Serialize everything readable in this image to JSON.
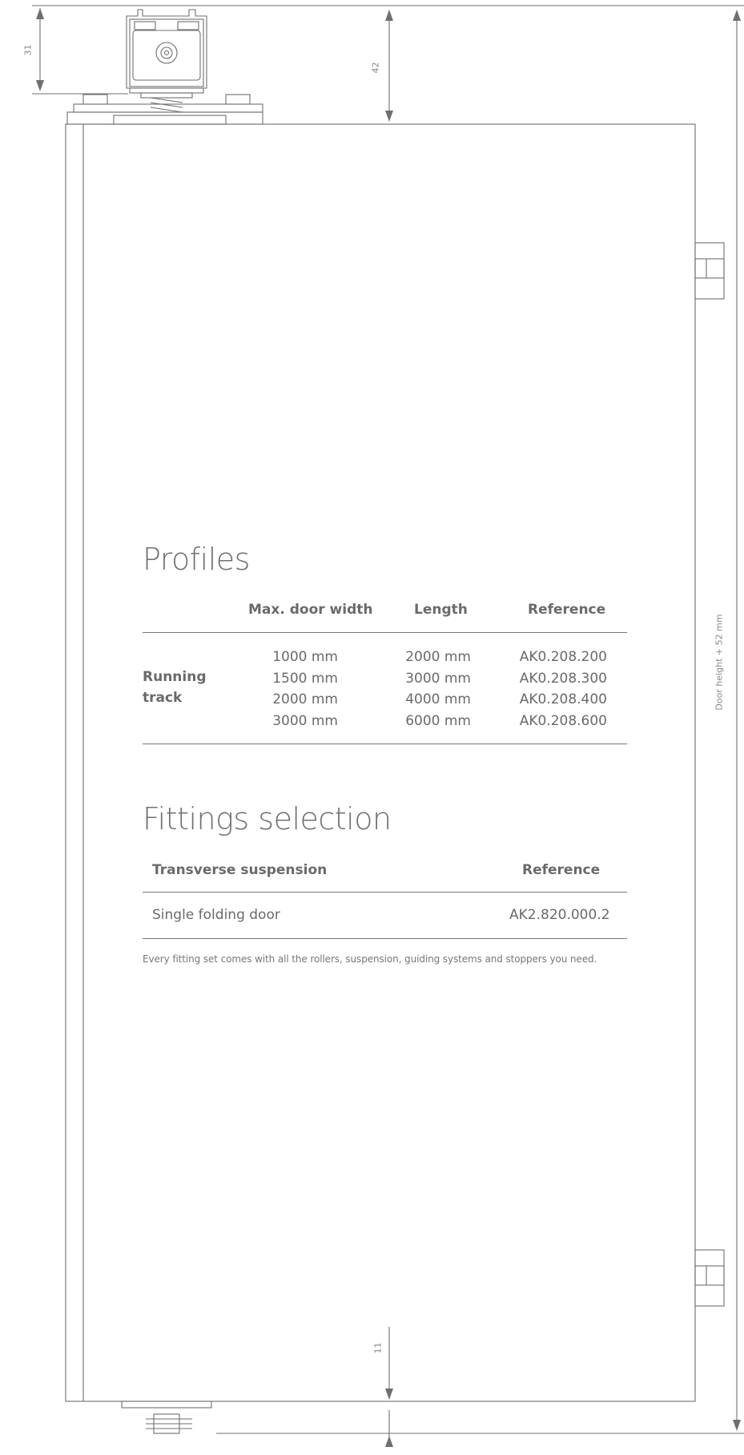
{
  "dimensions": {
    "top_left": "31",
    "top_center": "42",
    "bottom_center": "11",
    "right_total": "Door height + 52 mm"
  },
  "profiles": {
    "title": "Profiles",
    "headers": [
      "Max. door width",
      "Length",
      "Reference"
    ],
    "row_label_line1": "Running",
    "row_label_line2": "track",
    "widths": [
      "1000 mm",
      "1500 mm",
      "2000 mm",
      "3000 mm"
    ],
    "lengths": [
      "2000 mm",
      "3000 mm",
      "4000 mm",
      "6000 mm"
    ],
    "references": [
      "AK0.208.200",
      "AK0.208.300",
      "AK0.208.400",
      "AK0.208.600"
    ]
  },
  "fittings": {
    "title": "Fittings selection",
    "header_left": "Transverse suspension",
    "header_right": "Reference",
    "row_label": "Single folding door",
    "row_reference": "AK2.820.000.2",
    "note": "Every fitting set comes with all the rollers, suspension, guiding systems and stoppers you need."
  },
  "colors": {
    "line": "#6f6f6f",
    "text": "#6a6a6a"
  }
}
